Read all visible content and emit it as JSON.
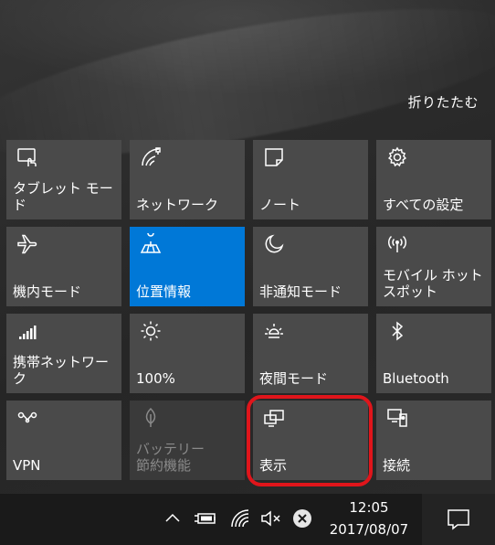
{
  "header": {
    "collapse_label": "折りたたむ"
  },
  "tiles": [
    {
      "label": "タブレット モード",
      "icon": "tablet-mode-icon"
    },
    {
      "label": "ネットワーク",
      "icon": "network-icon"
    },
    {
      "label": "ノート",
      "icon": "note-icon"
    },
    {
      "label": "すべての設定",
      "icon": "gear-icon"
    },
    {
      "label": "機内モード",
      "icon": "airplane-icon"
    },
    {
      "label": "位置情報",
      "icon": "location-icon",
      "state": "on"
    },
    {
      "label": "非通知モード",
      "icon": "moon-icon"
    },
    {
      "label": "モバイル ホットスポット",
      "icon": "hotspot-icon"
    },
    {
      "label": "携帯ネットワーク",
      "icon": "cellular-icon"
    },
    {
      "label": "100%",
      "icon": "brightness-icon"
    },
    {
      "label": "夜間モード",
      "icon": "night-light-icon"
    },
    {
      "label": "Bluetooth",
      "icon": "bluetooth-icon"
    },
    {
      "label": "VPN",
      "icon": "vpn-icon"
    },
    {
      "label": "バッテリー 節約機能",
      "icon": "battery-saver-icon",
      "state": "disabled"
    },
    {
      "label": "表示",
      "icon": "project-icon",
      "highlighted": true
    },
    {
      "label": "接続",
      "icon": "connect-icon"
    }
  ],
  "taskbar": {
    "time": "12:05",
    "date": "2017/08/07",
    "tray_icons": [
      "chevron-up-icon",
      "battery-plug-icon",
      "wifi-icon",
      "speaker-mute-icon",
      "close-circle-icon"
    ],
    "notification_icon": "action-center-icon"
  },
  "colors": {
    "accent": "#0078d7",
    "tile": "#4a4a4a",
    "highlight": "#e0151b"
  }
}
